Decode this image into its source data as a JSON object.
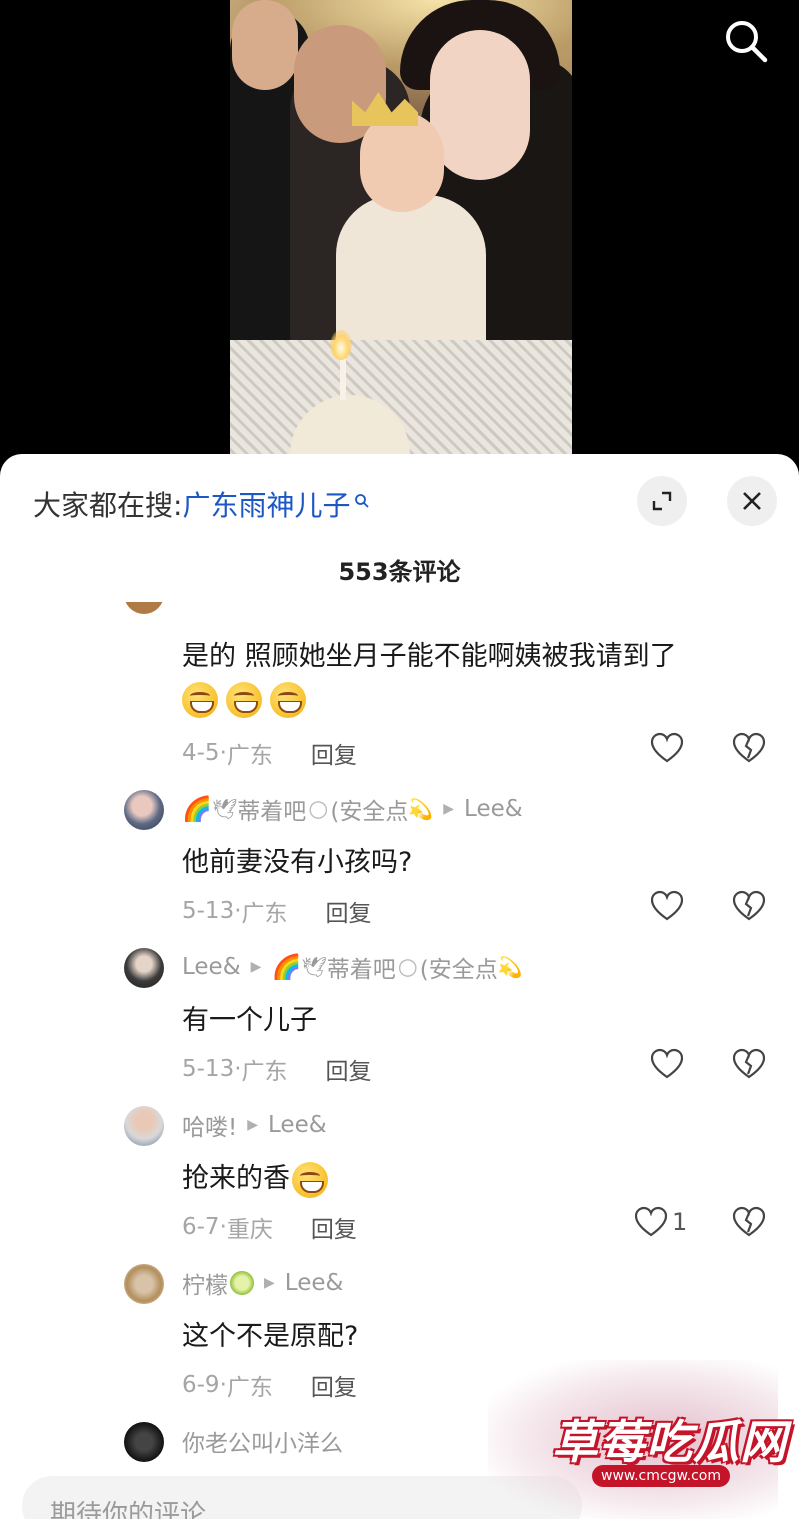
{
  "search_hint": {
    "prefix": "大家都在搜:",
    "term": "广东雨神儿子"
  },
  "comment_count": "553条评论",
  "comments": [
    {
      "text": "是的 照顾她坐月子能不能啊姨被我请到了",
      "date": "4-5",
      "location": "广东",
      "reply": "回复",
      "likes": ""
    },
    {
      "author": "蒂着吧",
      "author_suffix": "(安全点",
      "reply_to": "Lee&",
      "text": "他前妻没有小孩吗?",
      "date": "5-13",
      "location": "广东",
      "reply": "回复",
      "likes": ""
    },
    {
      "author": "Lee&",
      "reply_to": "蒂着吧",
      "reply_to_suffix": "(安全点",
      "text": "有一个儿子",
      "date": "5-13",
      "location": "广东",
      "reply": "回复",
      "likes": ""
    },
    {
      "author": "哈喽!",
      "reply_to": "Lee&",
      "text": "抢来的香",
      "date": "6-7",
      "location": "重庆",
      "reply": "回复",
      "likes": "1"
    },
    {
      "author": "柠檬",
      "reply_to": "Lee&",
      "text": "这个不是原配?",
      "date": "6-9",
      "location": "广东",
      "reply": "回复",
      "likes": ""
    },
    {
      "text": "你老公叫小洋么"
    }
  ],
  "input": {
    "placeholder": "期待你的评论"
  },
  "watermark": {
    "title": "草莓吃瓜网",
    "url": "www.cmcgw.com"
  },
  "colors": {
    "link_blue": "#1c57c4",
    "watermark_red": "#c4142a"
  },
  "icons": [
    "search-icon",
    "expand-icon",
    "close-icon",
    "heart-icon",
    "broken-heart-icon",
    "grin-sweat-emoji",
    "grin-emoji",
    "lime-emoji",
    "rainbow-emoji",
    "dove-emoji",
    "shooting-star-emoji"
  ]
}
